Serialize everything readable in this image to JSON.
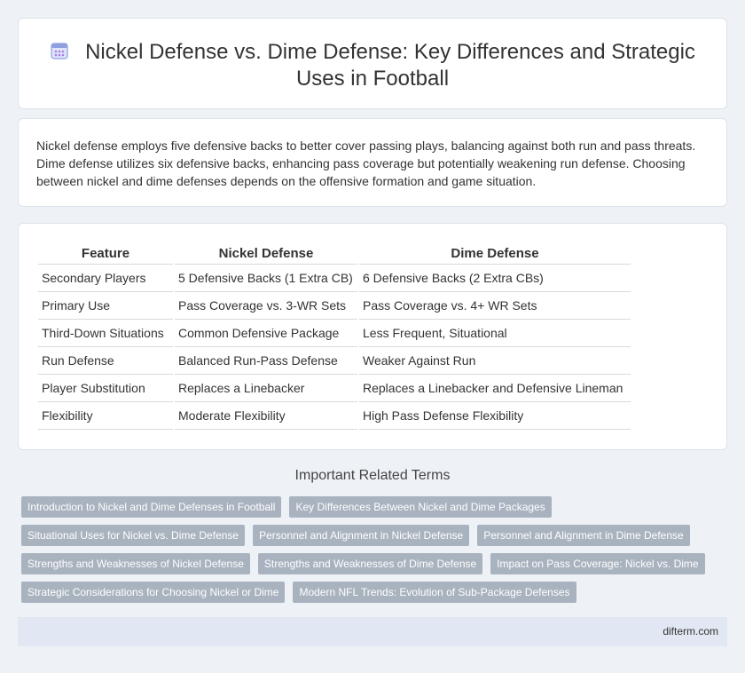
{
  "title": {
    "line1": "Nickel Defense vs. Dime Defense: Key Differences and Strategic",
    "line2": "Uses in Football",
    "icon": "calendar-icon"
  },
  "summary": "Nickel defense employs five defensive backs to better cover passing plays, balancing against both run and pass threats. Dime defense utilizes six defensive backs, enhancing pass coverage but potentially weakening run defense. Choosing between nickel and dime defenses depends on the offensive formation and game situation.",
  "table": {
    "headers": [
      "Feature",
      "Nickel Defense",
      "Dime Defense"
    ],
    "rows": [
      [
        "Secondary Players",
        "5 Defensive Backs (1 Extra CB)",
        "6 Defensive Backs (2 Extra CBs)"
      ],
      [
        "Primary Use",
        "Pass Coverage vs. 3-WR Sets",
        "Pass Coverage vs. 4+ WR Sets"
      ],
      [
        "Third-Down Situations",
        "Common Defensive Package",
        "Less Frequent, Situational"
      ],
      [
        "Run Defense",
        "Balanced Run-Pass Defense",
        "Weaker Against Run"
      ],
      [
        "Player Substitution",
        "Replaces a Linebacker",
        "Replaces a Linebacker and Defensive Lineman"
      ],
      [
        "Flexibility",
        "Moderate Flexibility",
        "High Pass Defense Flexibility"
      ]
    ]
  },
  "related": {
    "title": "Important Related Terms",
    "rows": [
      [
        "Introduction to Nickel and Dime Defenses in Football",
        "Key Differences Between Nickel and Dime Packages"
      ],
      [
        "Situational Uses for Nickel vs. Dime Defense",
        "Personnel and Alignment in Nickel Defense",
        "Personnel and Alignment in Dime Defense"
      ],
      [
        "Strengths and Weaknesses of Nickel Defense",
        "Strengths and Weaknesses of Dime Defense",
        "Impact on Pass Coverage: Nickel vs. Dime"
      ],
      [
        "Strategic Considerations for Choosing Nickel or Dime",
        "Modern NFL Trends: Evolution of Sub-Package Defenses"
      ]
    ]
  },
  "footer": "difterm.com",
  "colors": {
    "background": "#eef2f7",
    "tag": "#a9b3bf",
    "footer": "#e1e8f3",
    "icon": "#7b8fd6"
  }
}
